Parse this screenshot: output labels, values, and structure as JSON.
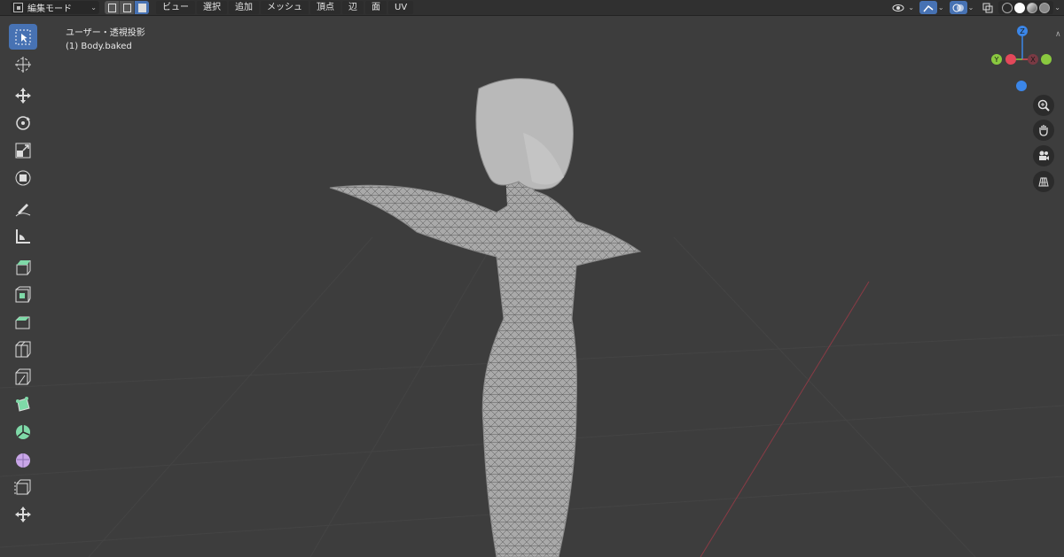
{
  "header": {
    "mode_label": "編集モード",
    "menu": [
      "ビュー",
      "選択",
      "追加",
      "メッシュ",
      "頂点",
      "辺",
      "面",
      "UV"
    ]
  },
  "viewport": {
    "view_label": "ユーザー・透視投影",
    "object_label": "(1) Body.baked"
  },
  "gizmo": {
    "z_label": "Z",
    "y_label": "Y",
    "x_label": "X",
    "colors": {
      "x": "#e3485a",
      "y": "#8ac93f",
      "z": "#3b86e8",
      "neg_x": "#7a3a44",
      "neg_y": "#4d6d2d"
    }
  },
  "toolbar": {
    "tools": [
      "select-box",
      "cursor",
      "move",
      "rotate",
      "scale",
      "transform",
      "annotate",
      "measure",
      "extrude-region",
      "inset-faces",
      "bevel",
      "loop-cut",
      "knife",
      "poly-build",
      "spin",
      "smooth",
      "edge-slide",
      "shrink-fatten"
    ],
    "accent": "#4772b3"
  },
  "nav_icons": [
    "zoom-icon",
    "pan-hand-icon",
    "camera-icon",
    "ortho-grid-icon"
  ]
}
